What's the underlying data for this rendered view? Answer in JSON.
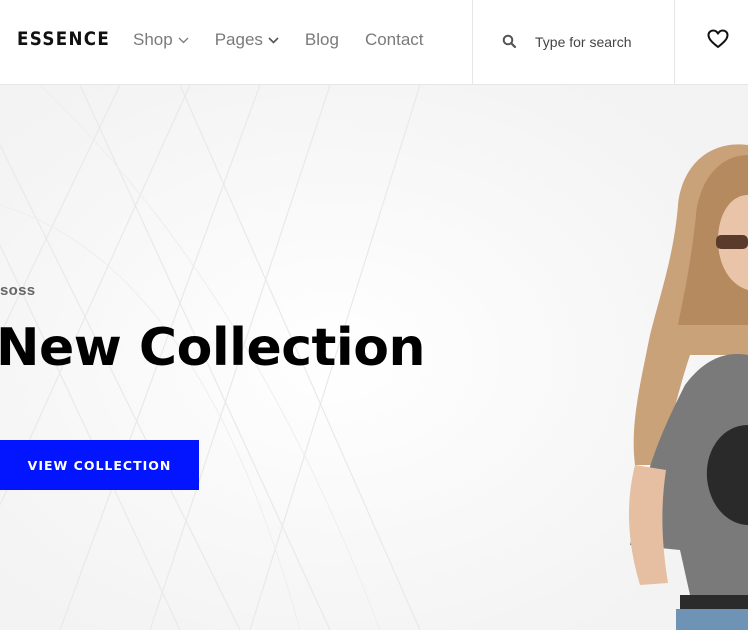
{
  "header": {
    "logo": "ESSENCE",
    "nav": [
      {
        "label": "Shop",
        "dropdown": true
      },
      {
        "label": "Pages",
        "dropdown": true
      },
      {
        "label": "Blog",
        "dropdown": false
      },
      {
        "label": "Contact",
        "dropdown": false
      }
    ],
    "search": {
      "placeholder": "Type for search",
      "icon": "search-icon"
    },
    "wishlist_icon": "heart-icon"
  },
  "hero": {
    "brand_tag": "soss",
    "title": "New Collection",
    "cta_label": "VIEW COLLECTION",
    "cta_color": "#0315ff"
  }
}
